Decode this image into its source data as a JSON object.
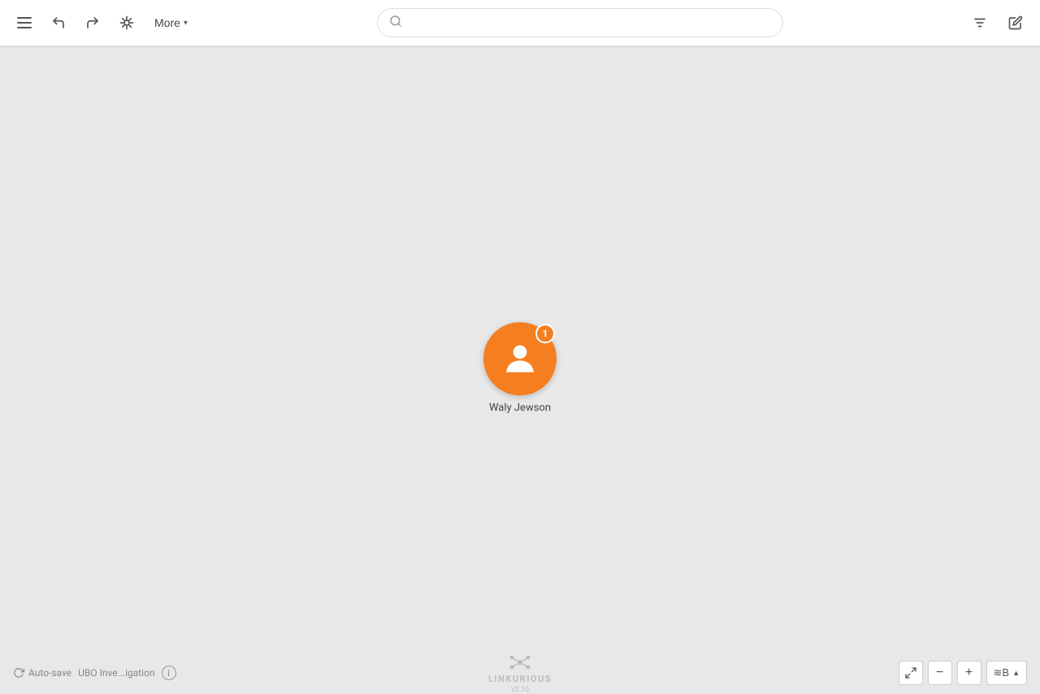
{
  "toolbar": {
    "more_label": "More",
    "search_placeholder": ""
  },
  "node": {
    "label": "Waly Jewson",
    "badge_count": "1",
    "color": "#f47e20"
  },
  "bottom": {
    "autosave_label": "Auto-save",
    "investigation_label": "UBO Inve...igation",
    "logo_text": "LINKURIOUS",
    "logo_version": "v2.10",
    "zoom_minus": "−",
    "zoom_plus": "+",
    "graph_mode": "≋B"
  }
}
